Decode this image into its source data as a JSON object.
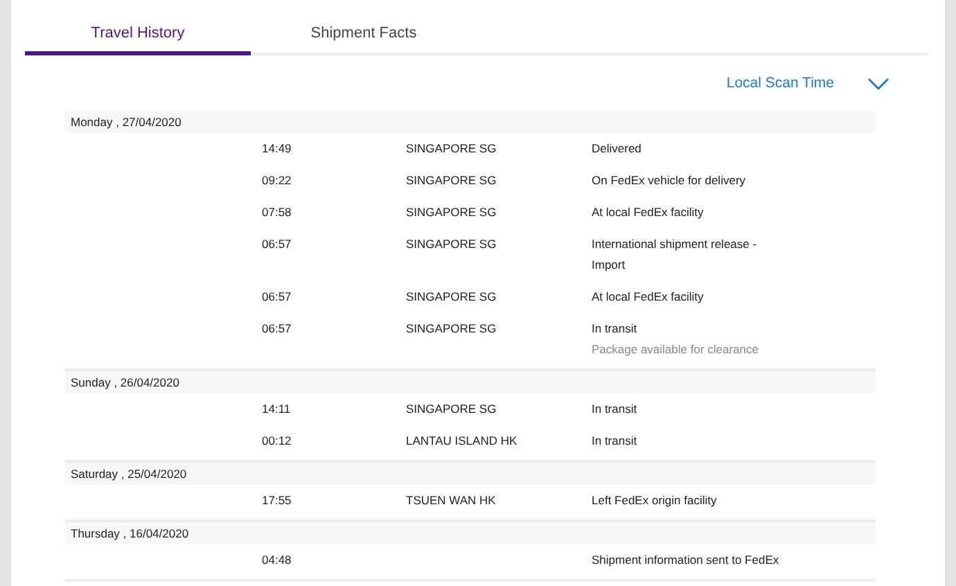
{
  "tabs": [
    {
      "label": "Travel History",
      "selected": true
    },
    {
      "label": "Shipment Facts",
      "selected": false
    }
  ],
  "time_selector": {
    "label": "Local Scan Time",
    "expanded": false
  },
  "days": [
    {
      "date": "Monday , 27/04/2020",
      "events": [
        {
          "time": "14:49",
          "location": "SINGAPORE SG",
          "status": "Delivered"
        },
        {
          "time": "09:22",
          "location": "SINGAPORE SG",
          "status": "On FedEx vehicle for delivery"
        },
        {
          "time": "07:58",
          "location": "SINGAPORE SG",
          "status": "At local FedEx facility"
        },
        {
          "time": "06:57",
          "location": "SINGAPORE SG",
          "status": "International shipment release - Import"
        },
        {
          "time": "06:57",
          "location": "SINGAPORE SG",
          "status": "At local FedEx facility"
        },
        {
          "time": "06:57",
          "location": "SINGAPORE SG",
          "status": "In transit",
          "note": "Package available for clearance"
        }
      ]
    },
    {
      "date": "Sunday , 26/04/2020",
      "events": [
        {
          "time": "14:11",
          "location": "SINGAPORE SG",
          "status": "In transit"
        },
        {
          "time": "00:12",
          "location": "LANTAU ISLAND HK",
          "status": "In transit"
        }
      ]
    },
    {
      "date": "Saturday , 25/04/2020",
      "events": [
        {
          "time": "17:55",
          "location": "TSUEN WAN HK",
          "status": "Left FedEx origin facility"
        }
      ]
    },
    {
      "date": "Thursday , 16/04/2020",
      "events": [
        {
          "time": "04:48",
          "status": "Shipment information sent to FedEx"
        }
      ]
    }
  ]
}
